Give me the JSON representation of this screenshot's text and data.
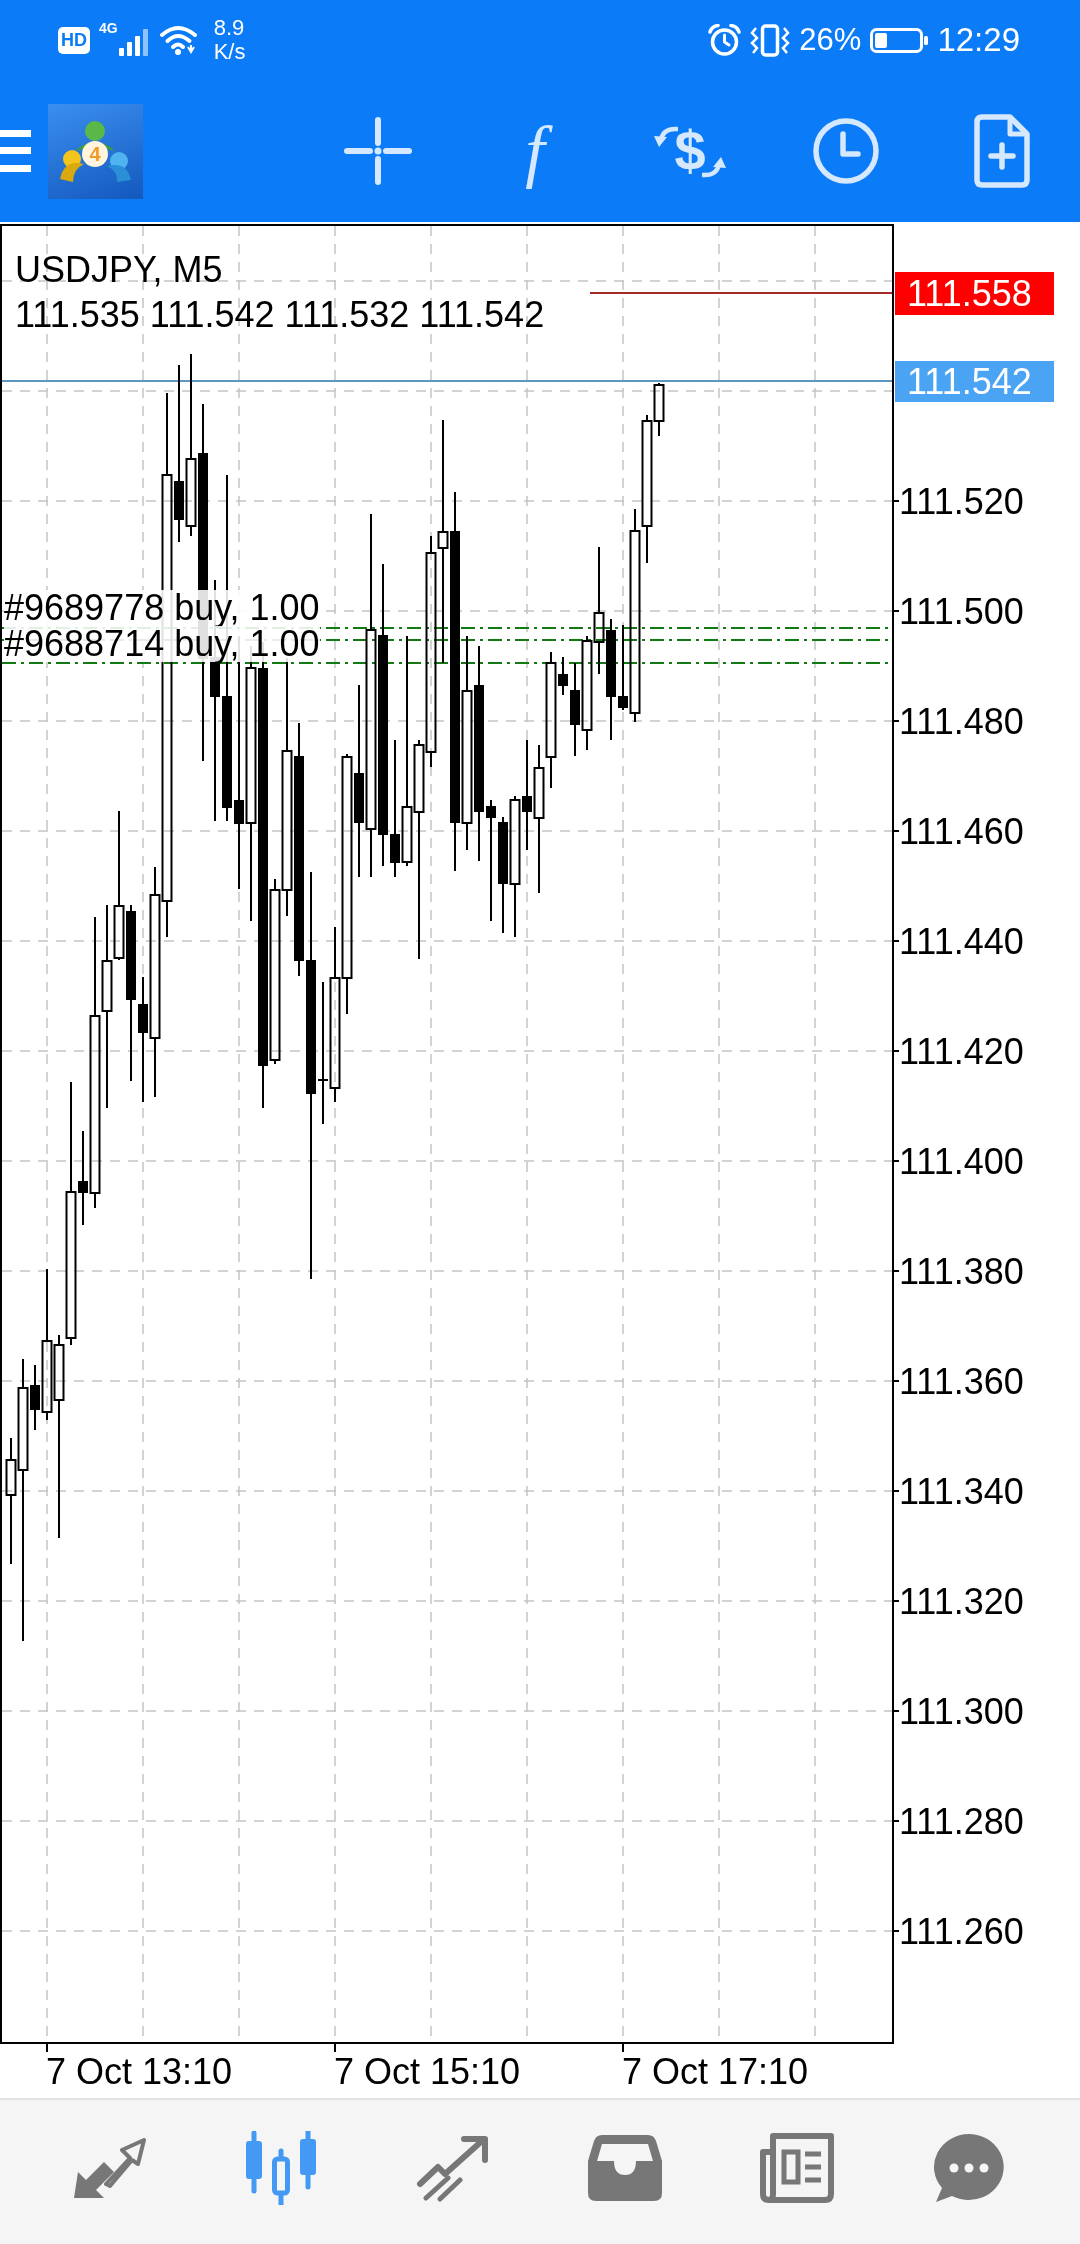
{
  "status_bar": {
    "network_badge": "HD",
    "network_type": "4G",
    "speed": "8.9",
    "speed_unit": "K/s",
    "battery_percent": "26%",
    "time": "12:29"
  },
  "toolbar": {
    "logo_badge": "4",
    "function_glyph": "f",
    "currency_glyph": "$"
  },
  "chart": {
    "symbol": "USDJPY, M5",
    "ohlc": "111.535 111.542 111.532 111.542",
    "ask_tag": "111.558",
    "bid_tag": "111.542",
    "orders": [
      "#9689778 buy, 1.00",
      "#9688714 buy, 1.00"
    ],
    "price_labels": [
      "111.520",
      "111.500",
      "111.480",
      "111.460",
      "111.440",
      "111.420",
      "111.400",
      "111.380",
      "111.360",
      "111.340",
      "111.320",
      "111.300",
      "111.280",
      "111.260"
    ],
    "time_labels": [
      "7 Oct 13:10",
      "7 Oct 15:10",
      "7 Oct 17:10"
    ]
  },
  "bottom_nav": [
    {
      "selected": false
    },
    {
      "selected": true
    },
    {
      "selected": false
    },
    {
      "selected": false
    },
    {
      "selected": false
    },
    {
      "selected": false
    }
  ]
}
